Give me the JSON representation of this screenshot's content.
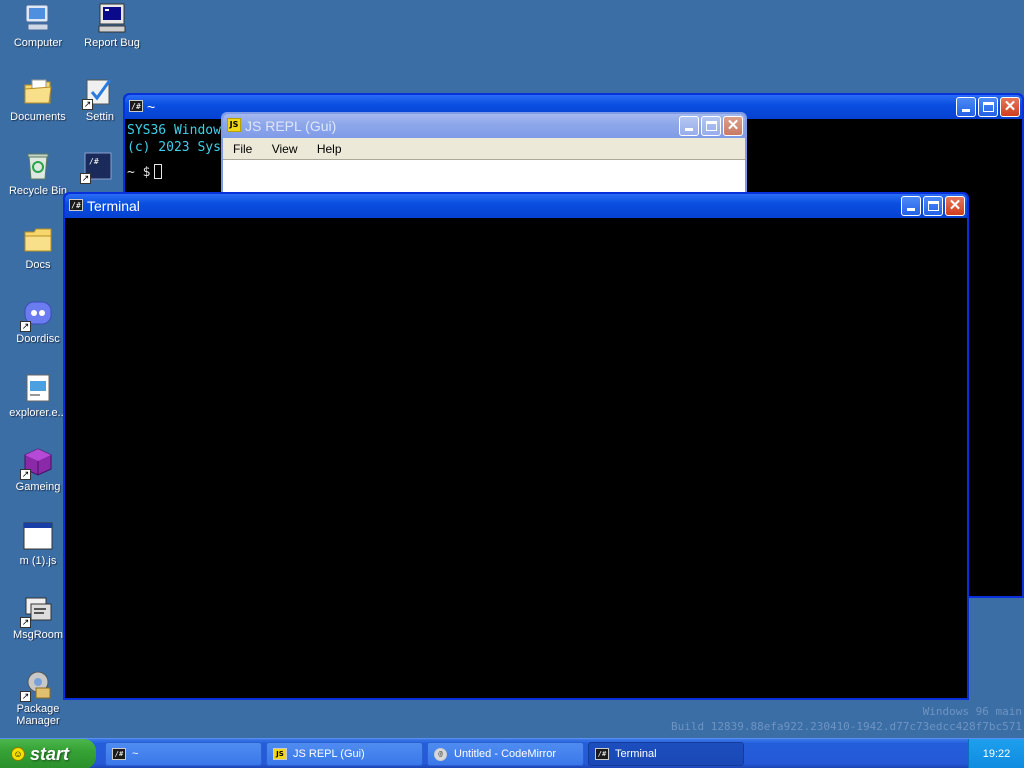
{
  "desktop": {
    "icons": [
      {
        "label": "Computer",
        "icon": "computer-icon"
      },
      {
        "label": "Report Bug",
        "icon": "report-bug-icon"
      },
      {
        "label": "Documents",
        "icon": "documents-folder-icon"
      },
      {
        "label": "Settin",
        "icon": "settings-icon"
      },
      {
        "label": "Recycle Bin",
        "icon": "recycle-bin-icon"
      },
      {
        "label": "Docs",
        "icon": "folder-icon"
      },
      {
        "label": "Doordisc",
        "icon": "doordisc-icon"
      },
      {
        "label": "explorer.e...",
        "icon": "explorer-icon"
      },
      {
        "label": "Gameing",
        "icon": "gameing-icon"
      },
      {
        "label": "m (1).js",
        "icon": "js-file-icon"
      },
      {
        "label": "MsgRoom",
        "icon": "msgroom-icon"
      },
      {
        "label": "Package Manager",
        "icon": "package-manager-icon"
      }
    ]
  },
  "windows": {
    "back_terminal": {
      "title": "~",
      "icon_text": "/#",
      "lines": [
        "SYS36 Windows 96",
        "(c) 2023 Sys"
      ],
      "prompt": "~ $"
    },
    "js_repl": {
      "title": "JS REPL (Gui)",
      "icon_text": "JS",
      "menu": [
        "File",
        "View",
        "Help"
      ]
    },
    "terminal": {
      "title": "Terminal",
      "icon_text": "/#"
    }
  },
  "watermark": {
    "line1": "Windows 96 main",
    "line2": "Build 12839.88efa922.230410-1942.d77c73edcc428f7bc571"
  },
  "taskbar": {
    "start_label": "start",
    "tasks": [
      {
        "label": "~",
        "icon": "terminal-icon",
        "icon_text": "/#"
      },
      {
        "label": "JS REPL (Gui)",
        "icon": "js-icon",
        "icon_text": "JS"
      },
      {
        "label": "Untitled - CodeMirror",
        "icon": "codemirror-icon",
        "icon_text": "@"
      },
      {
        "label": "Terminal",
        "icon": "terminal-icon",
        "icon_text": "/#"
      }
    ],
    "clock": "19:22"
  },
  "colors": {
    "desktop": "#3a6ea5",
    "titlebar_active": "#0541d2",
    "titlebar_inactive": "#7f9be8",
    "terminal_text": "#3fd0e8"
  }
}
